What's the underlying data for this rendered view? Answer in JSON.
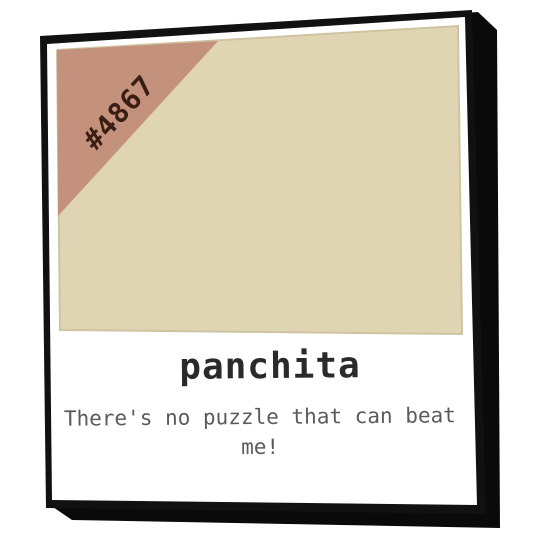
{
  "card": {
    "number_badge": "#4867",
    "name": "panchita",
    "quote": "There's no puzzle that can beat me!"
  },
  "colors": {
    "card_border": "#111111",
    "card_shadow": "#0a0a0a",
    "card_face": "#ffffff",
    "photo_area": "#e0d5b3",
    "photo_edge": "#cfc4a2",
    "badge_fill": "#c4927c",
    "badge_text": "#3a1e14",
    "name_text": "#2a2a2a",
    "quote_text": "#5a5a5a"
  }
}
